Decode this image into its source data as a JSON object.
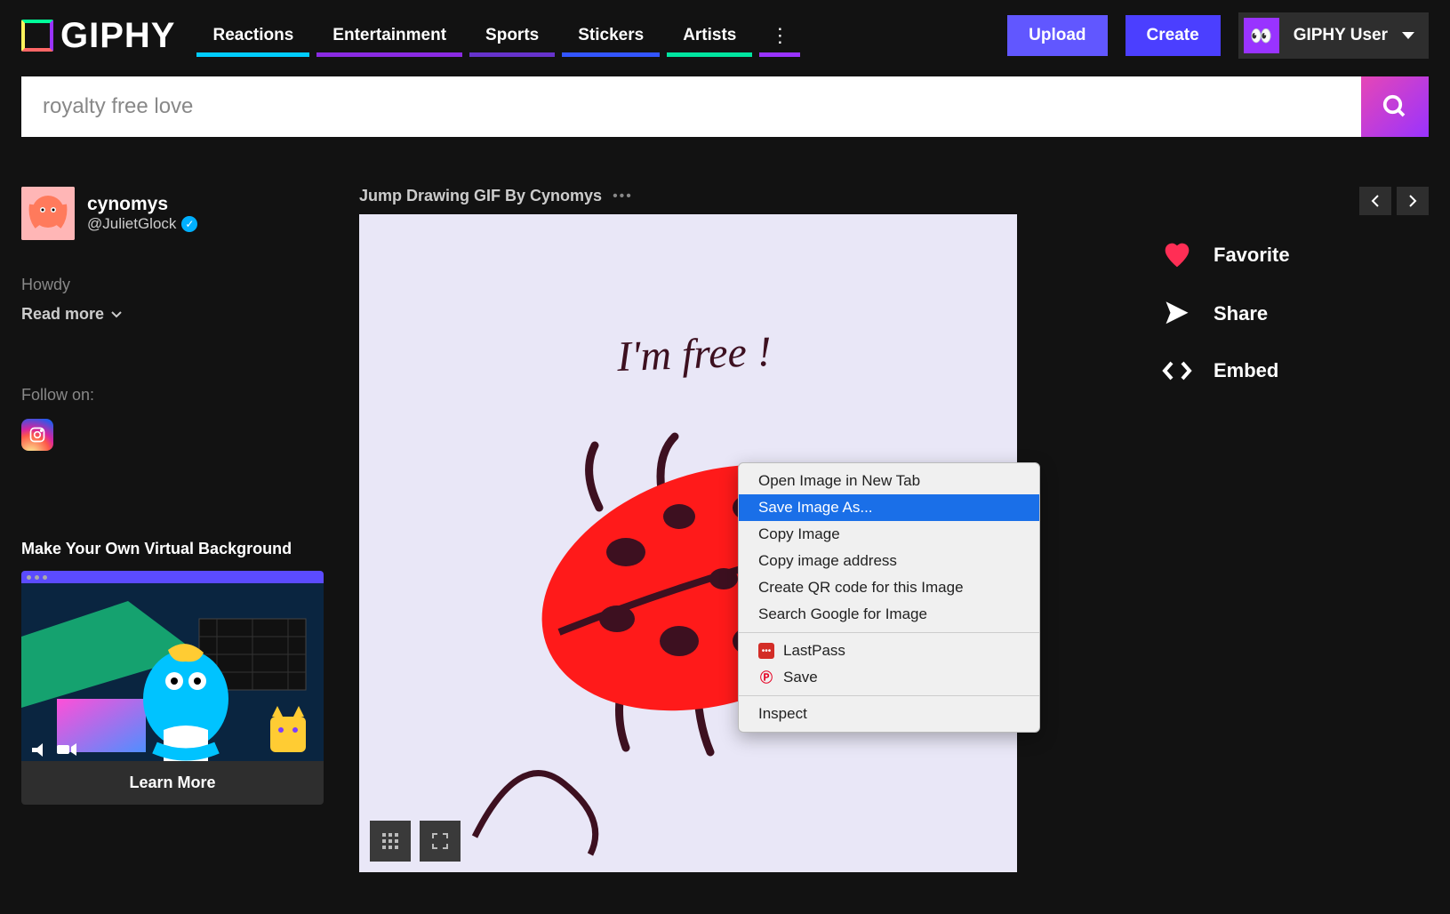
{
  "header": {
    "logo_text": "GIPHY",
    "nav": [
      "Reactions",
      "Entertainment",
      "Sports",
      "Stickers",
      "Artists"
    ],
    "upload": "Upload",
    "create": "Create",
    "user": "GIPHY User",
    "avatar_glyph": "👀"
  },
  "search": {
    "value": "royalty free love"
  },
  "profile": {
    "name": "cynomys",
    "handle": "@JulietGlock",
    "howdy": "Howdy",
    "readmore": "Read more",
    "follow": "Follow on:"
  },
  "promo": {
    "title": "Make Your Own Virtual Background",
    "cta": "Learn More"
  },
  "gif": {
    "title": "Jump Drawing GIF By Cynomys",
    "caption": "I'm free !"
  },
  "actions": {
    "favorite": "Favorite",
    "share": "Share",
    "embed": "Embed"
  },
  "context_menu": {
    "items": [
      "Open Image in New Tab",
      "Save Image As...",
      "Copy Image",
      "Copy image address",
      "Create QR code for this Image",
      "Search Google for Image"
    ],
    "lastpass": "LastPass",
    "pinterest_save": "Save",
    "inspect": "Inspect",
    "highlighted_index": 1
  }
}
